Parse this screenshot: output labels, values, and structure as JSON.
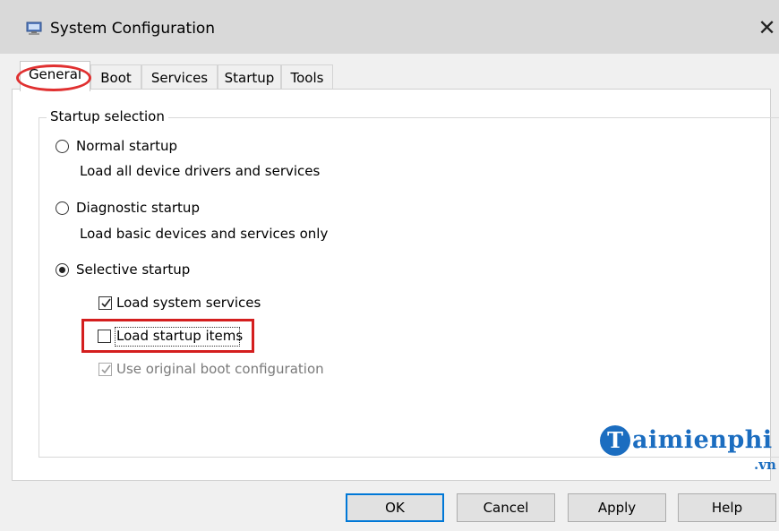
{
  "window": {
    "title": "System Configuration",
    "close_glyph": "✕",
    "icon": "system-config-icon"
  },
  "tabs": [
    {
      "label": "General",
      "active": true
    },
    {
      "label": "Boot",
      "active": false
    },
    {
      "label": "Services",
      "active": false
    },
    {
      "label": "Startup",
      "active": false
    },
    {
      "label": "Tools",
      "active": false
    }
  ],
  "startup_selection": {
    "title": "Startup selection",
    "normal": {
      "label": "Normal startup",
      "desc": "Load all device drivers and services",
      "selected": false
    },
    "diagnostic": {
      "label": "Diagnostic startup",
      "desc": "Load basic devices and services only",
      "selected": false
    },
    "selective": {
      "label": "Selective startup",
      "selected": true
    },
    "options": [
      {
        "label": "Load system services",
        "checked": true,
        "enabled": true
      },
      {
        "label": "Load startup items",
        "checked": false,
        "enabled": true
      },
      {
        "label": "Use original boot configuration",
        "checked": true,
        "enabled": false
      }
    ]
  },
  "buttons": {
    "ok": "OK",
    "cancel": "Cancel",
    "apply": "Apply",
    "help": "Help"
  },
  "watermark": {
    "initial": "T",
    "text": "aimienphi",
    "suffix": ".vn"
  },
  "colors": {
    "highlight_red": "#d41e1e",
    "focus_blue": "#0078d7",
    "watermark_blue": "#1b6dc0"
  }
}
